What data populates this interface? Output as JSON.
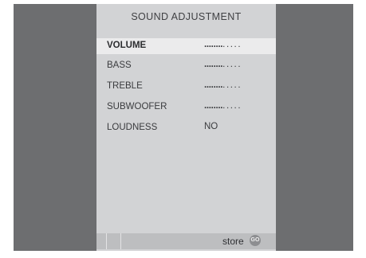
{
  "menu": {
    "title": "SOUND ADJUSTMENT",
    "items": [
      {
        "label": "VOLUME",
        "value_filled": "........",
        "value_empty": ".....",
        "level": 0.62,
        "selected": true
      },
      {
        "label": "BASS",
        "value_filled": "........",
        "value_empty": ".....",
        "level": 0.62
      },
      {
        "label": "TREBLE",
        "value_filled": "........",
        "value_empty": ".....",
        "level": 0.62
      },
      {
        "label": "SUBWOOFER",
        "value_filled": "........",
        "value_empty": ".....",
        "level": 0.62
      },
      {
        "label": "LOUDNESS",
        "value": "NO"
      }
    ]
  },
  "footer": {
    "store_label": "store",
    "go_icon_text": "GO"
  },
  "colors": {
    "background": "#6d6e70",
    "panel": "#d2d3d5",
    "selected_row": "#ebebec",
    "footer_bar": "#bdbec0"
  }
}
